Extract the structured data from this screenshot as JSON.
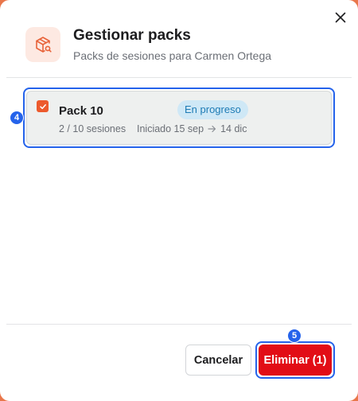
{
  "dialog": {
    "title": "Gestionar packs",
    "subtitle": "Packs de sesiones para Carmen Ortega",
    "header_icon": "package-search-icon",
    "close_icon": "close-icon"
  },
  "packs": [
    {
      "name": "Pack 10",
      "checked": true,
      "status": "En progreso",
      "sessions": "2 / 10 sesiones",
      "started": "Iniciado 15 sep",
      "ends": "14 dic"
    }
  ],
  "steps": {
    "pack": "4",
    "delete": "5"
  },
  "footer": {
    "cancel_label": "Cancelar",
    "delete_label": "Eliminar (1)"
  },
  "colors": {
    "accent": "#ec5a2d",
    "danger": "#e20d16",
    "focus": "#2563eb",
    "status_bg": "#cfe8f6",
    "status_text": "#1d7bb5"
  }
}
